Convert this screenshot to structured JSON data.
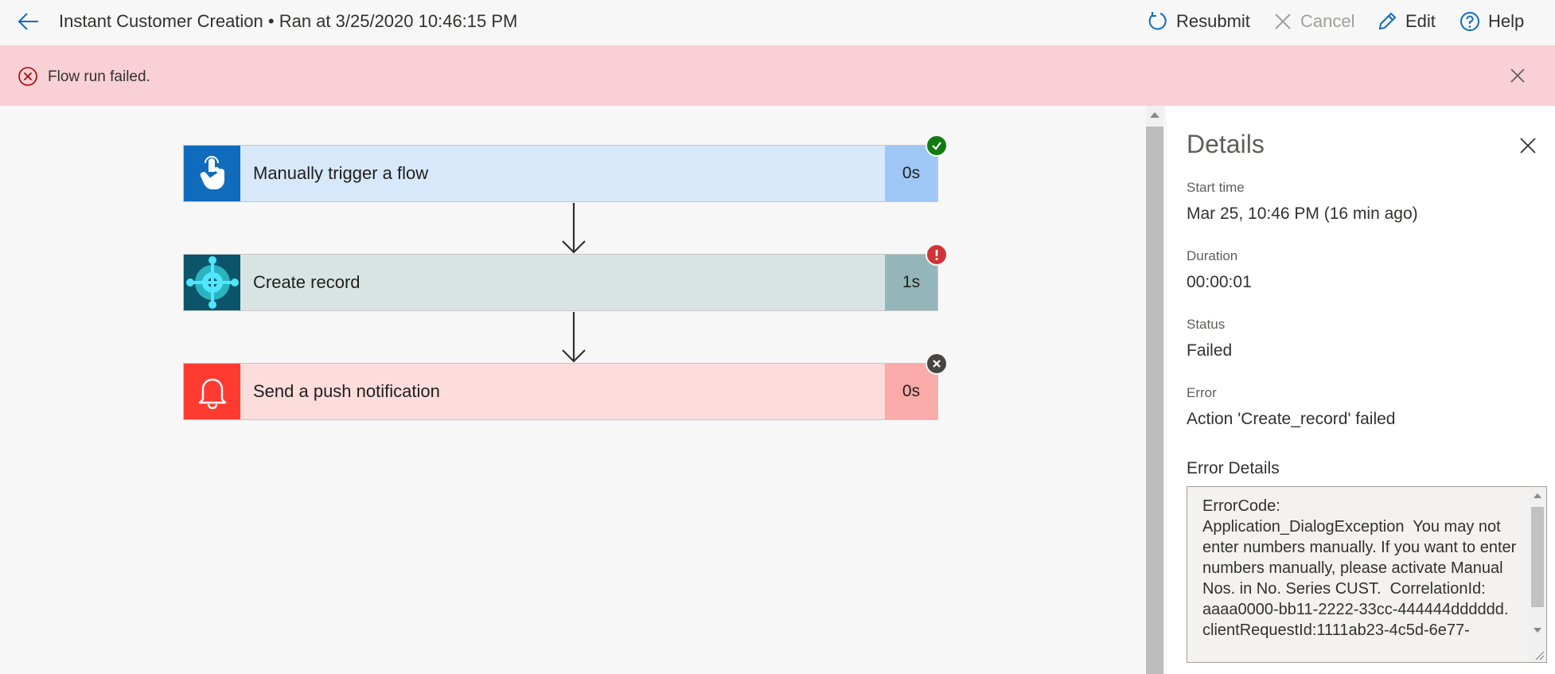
{
  "header": {
    "title": "Instant Customer Creation • Ran at 3/25/2020 10:46:15 PM",
    "back_icon": "arrow-left-icon",
    "commands": [
      {
        "label": "Resubmit",
        "icon": "refresh-icon",
        "enabled": true
      },
      {
        "label": "Cancel",
        "icon": "close-icon",
        "enabled": false
      },
      {
        "label": "Edit",
        "icon": "pencil-icon",
        "enabled": true
      },
      {
        "label": "Help",
        "icon": "help-circle-icon",
        "enabled": true
      }
    ]
  },
  "banner": {
    "message": "Flow run failed.",
    "background": "#f9d0d5"
  },
  "steps": [
    {
      "label": "Manually trigger a flow",
      "duration": "0s",
      "status": "succeeded",
      "icon": "touch-hand-icon",
      "accent": "#0f6cbd"
    },
    {
      "label": "Create record",
      "duration": "1s",
      "status": "failed",
      "icon": "business-central-icon",
      "accent": "#0b556a"
    },
    {
      "label": "Send a push notification",
      "duration": "0s",
      "status": "cancelled",
      "icon": "bell-icon",
      "accent": "#ff3b30"
    }
  ],
  "details": {
    "title": "Details",
    "start_time_label": "Start time",
    "start_time_value": "Mar 25, 10:46 PM (16 min ago)",
    "duration_label": "Duration",
    "duration_value": "00:00:01",
    "status_label": "Status",
    "status_value": "Failed",
    "error_label": "Error",
    "error_value": "Action 'Create_record' failed",
    "error_details_label": "Error Details",
    "error_details_text": "ErrorCode:\nApplication_DialogException  You may not enter numbers manually. If you want to enter numbers manually, please activate Manual Nos. in No. Series CUST.  CorrelationId:  aaaa0000-bb11-2222-33cc-444444dddddd.\nclientRequestId:1111ab23-4c5d-6e77-"
  }
}
